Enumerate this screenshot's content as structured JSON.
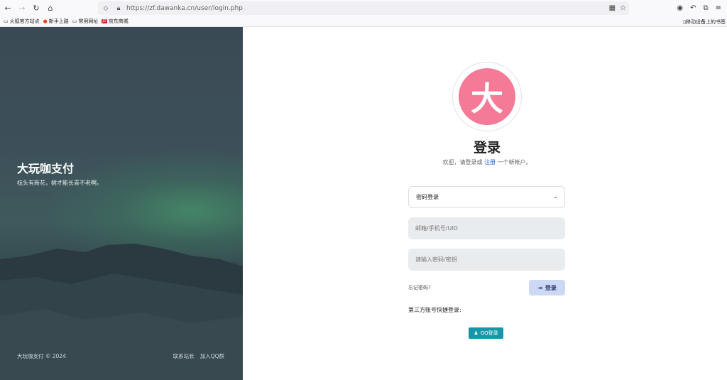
{
  "browser": {
    "url": "https://zf.dawanka.cn/user/login.php",
    "icons": [
      "back-icon",
      "forward-icon",
      "reload-icon",
      "home-icon",
      "shield-icon",
      "lock-icon",
      "qr-code-icon",
      "star-icon",
      "account-icon",
      "share-icon",
      "extensions-icon",
      "menu-icon"
    ]
  },
  "bookmarks": {
    "items": [
      {
        "label": "火狐官方站点"
      },
      {
        "label": "新手上路"
      },
      {
        "label": "常用网址"
      },
      {
        "label": "京东商城"
      }
    ],
    "mobile": "移动设备上的书签"
  },
  "hero": {
    "title": "大玩咖支付",
    "subtitle": "枝头有新花，树才能长青不老啊。",
    "copyright": "大玩咖支付 © 2024",
    "links": [
      "联系站长",
      "加入QQ群"
    ]
  },
  "login": {
    "logo_char": "大",
    "title": "登录",
    "welcome_before": "欢迎，请登录或",
    "register_link": "注册",
    "welcome_after": "一个新帐户。",
    "method_selected": "密码登录",
    "account_placeholder": "邮箱/手机号/UID",
    "password_placeholder": "请输入密码/密钥",
    "forgot": "忘记密码?",
    "submit": "登录",
    "third_party_label": "第三方账号快捷登录:",
    "qq_button": "QQ登录"
  },
  "colors": {
    "logo": "#f47a98",
    "qq": "#1697a8",
    "submit_bg": "#cdd8f4",
    "link": "#1e66d0"
  }
}
